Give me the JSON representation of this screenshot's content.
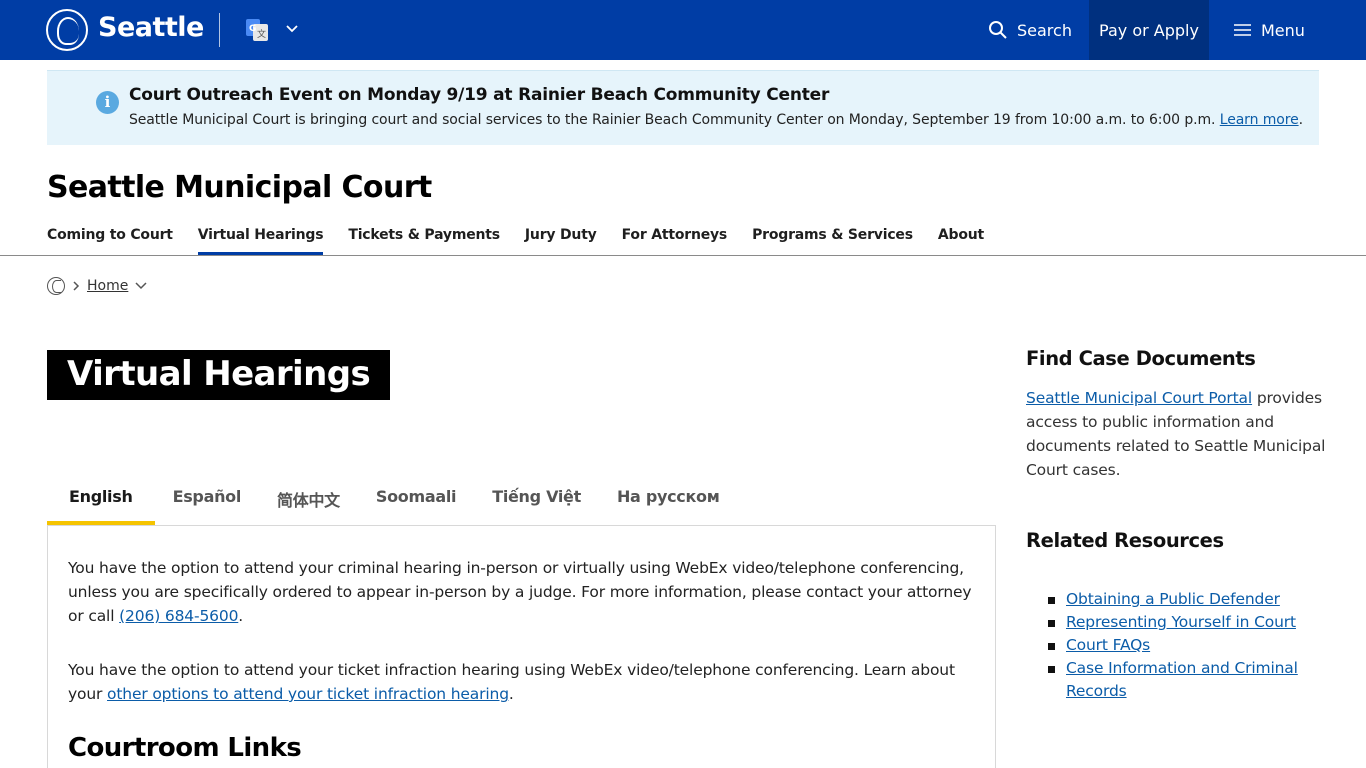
{
  "header": {
    "logo_text": "Seattle",
    "search_label": "Search",
    "pay_label": "Pay or Apply",
    "menu_label": "Menu",
    "colors": {
      "brand": "#003da5",
      "pay_bg": "#00307f"
    },
    "icons": [
      "seattle-logo-icon",
      "translate-icon",
      "chevron-down-icon",
      "search-icon",
      "hamburger-icon"
    ]
  },
  "alert": {
    "title": "Court Outreach Event on Monday 9/19 at Rainier Beach Community Center",
    "body": "Seattle Municipal Court is bringing court and social services to the Rainier Beach Community Center on Monday, September 19 from 10:00 a.m. to 6:00 p.m.",
    "link": "Learn more",
    "suffix": ".",
    "bg_color": "#e6f4fb"
  },
  "site": {
    "title": "Seattle Municipal Court"
  },
  "nav": {
    "items": [
      "Coming to Court",
      "Virtual Hearings",
      "Tickets & Payments",
      "Jury Duty",
      "For Attorneys",
      "Programs & Services",
      "About"
    ],
    "active": "Virtual Hearings"
  },
  "breadcrumb": {
    "home": "Home"
  },
  "page": {
    "heading": "Virtual Hearings"
  },
  "tabs": {
    "items": [
      "English",
      "Español",
      "简体中文",
      "Soomaali",
      "Tiếng Việt",
      "На русском"
    ],
    "active": "English",
    "accent": "#f5c400"
  },
  "content": {
    "p1_text": "You have the option to attend your criminal hearing in-person or virtually using WebEx video/telephone conferencing, unless you are specifically ordered to appear in-person by a judge. For more information, please contact your attorney or call ",
    "p1_link": "(206) 684-5600",
    "p1_end": ".",
    "p2_text": "You have the option to attend your ticket infraction hearing using WebEx video/telephone conferencing. Learn about your ",
    "p2_link": "other options to attend your ticket infraction hearing",
    "p2_end": ".",
    "section_heading": "Courtroom Links"
  },
  "sidebar": {
    "find_heading": "Find Case Documents",
    "portal_link": "Seattle Municipal Court Portal",
    "portal_text": " provides access to public information and documents related to Seattle Municipal Court cases.",
    "related_heading": "Related Resources",
    "resources": [
      "Obtaining a Public Defender",
      "Representing Yourself in Court",
      "Court FAQs",
      "Case Information and Criminal Records"
    ]
  }
}
